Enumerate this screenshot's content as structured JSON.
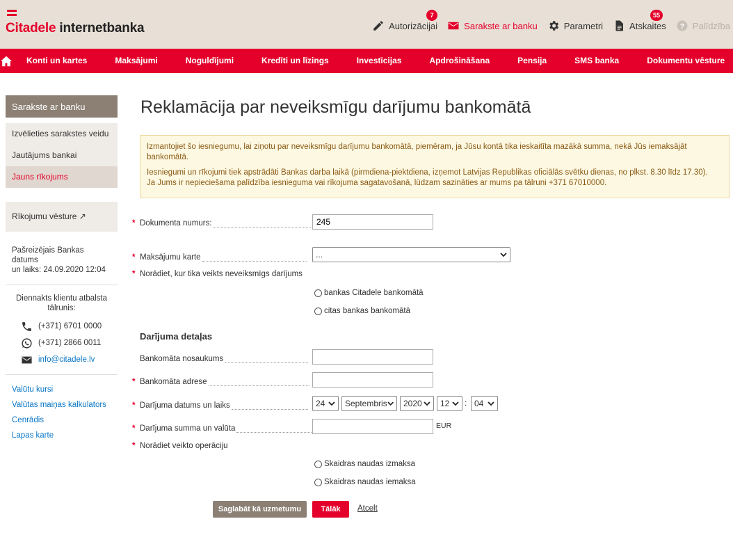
{
  "header": {
    "logo_brand": "Citadele",
    "logo_rest": " internetbanka",
    "actions": [
      {
        "label": "Autorizācijai",
        "badge": "7"
      },
      {
        "label": "Sarakste ar banku",
        "badge": ""
      },
      {
        "label": "Parametri",
        "badge": ""
      },
      {
        "label": "Atskaites",
        "badge": "55"
      },
      {
        "label": "Palīdzība",
        "badge": ""
      }
    ]
  },
  "nav": {
    "items": [
      "Konti un kartes",
      "Maksājumi",
      "Noguldījumi",
      "Kredīti un līzings",
      "Investīcijas",
      "Apdrošināšana",
      "Pensija",
      "SMS banka",
      "Dokumentu vēsture"
    ]
  },
  "sidebar": {
    "heading": "Sarakste ar banku",
    "items": [
      "Izvēlieties sarakstes veidu",
      "Jautājums bankai",
      "Jauns rīkojums"
    ],
    "history": "Rīkojumu vēsture ↗",
    "date_line1": "Pašreizējais Bankas datums",
    "date_line2": "un laiks: 24.09.2020 12:04",
    "support_title_1": "Diennakts klientu atbalsta",
    "support_title_2": "tālrunis:",
    "phone1": "(+371) 6701 0000",
    "phone2": "(+371) 2866 0011",
    "email": "info@citadele.lv",
    "links": [
      "Valūtu kursi",
      "Valūtas maiņas kalkulators",
      "Cenrādis",
      "Lapas karte"
    ]
  },
  "main": {
    "title": "Reklamācija par neveiksmīgu darījumu bankomātā",
    "notice_p1": "Izmantojiet šo iesniegumu, lai ziņotu par neveiksmīgu darījumu bankomātā, piemēram, ja Jūsu kontā tika ieskaitīta mazākā summa, nekā Jūs iemaksājāt bankomātā.",
    "notice_p2_line1": "Iesniegumi un rīkojumi tiek apstrādāti Bankas darba laikā (pirmdiena-piektdiena, izņemot Latvijas Republikas oficiālās svētku dienas, no plkst. 8.30 līdz 17.30).",
    "notice_p2_line2": "Ja Jums ir nepieciešama palīdzība iesnieguma vai rīkojuma sagatavošanā, lūdzam sazināties ar mums pa tālruni +371 67010000.",
    "doc_number_label": "Dokumenta numurs:",
    "doc_number_value": "245",
    "card_label": "Maksājumu karte",
    "card_value": "...",
    "where_label": "Norādiet, kur tika veikts neveiksmīgs darījums",
    "where_opt1": "bankas Citadele bankomātā",
    "where_opt2": "citas bankas bankomātā",
    "details_title": "Darījuma detaļas",
    "atm_name_label": "Bankomāta nosaukums",
    "atm_address_label": "Bankomāta adrese",
    "datetime_label": "Darījuma datums un laiks",
    "day": "24",
    "month": "Septembris",
    "year": "2020",
    "hour": "12",
    "minute": "04",
    "time_sep": ":",
    "amount_label": "Darījuma summa un valūta",
    "currency": "EUR",
    "operation_label": "Norādiet veikto operāciju",
    "op_opt1": "Skaidras naudas izmaksa",
    "op_opt2": "Skaidras naudas iemaksa",
    "save_button": "Saglabāt kā uzmetumu",
    "next_button": "Tālāk",
    "cancel_link": "Atcelt",
    "required_mark": "*"
  },
  "colors": {
    "brand_red": "#e4002b",
    "header_bg": "#e8e0d6",
    "sidebar_head": "#8c8074"
  }
}
